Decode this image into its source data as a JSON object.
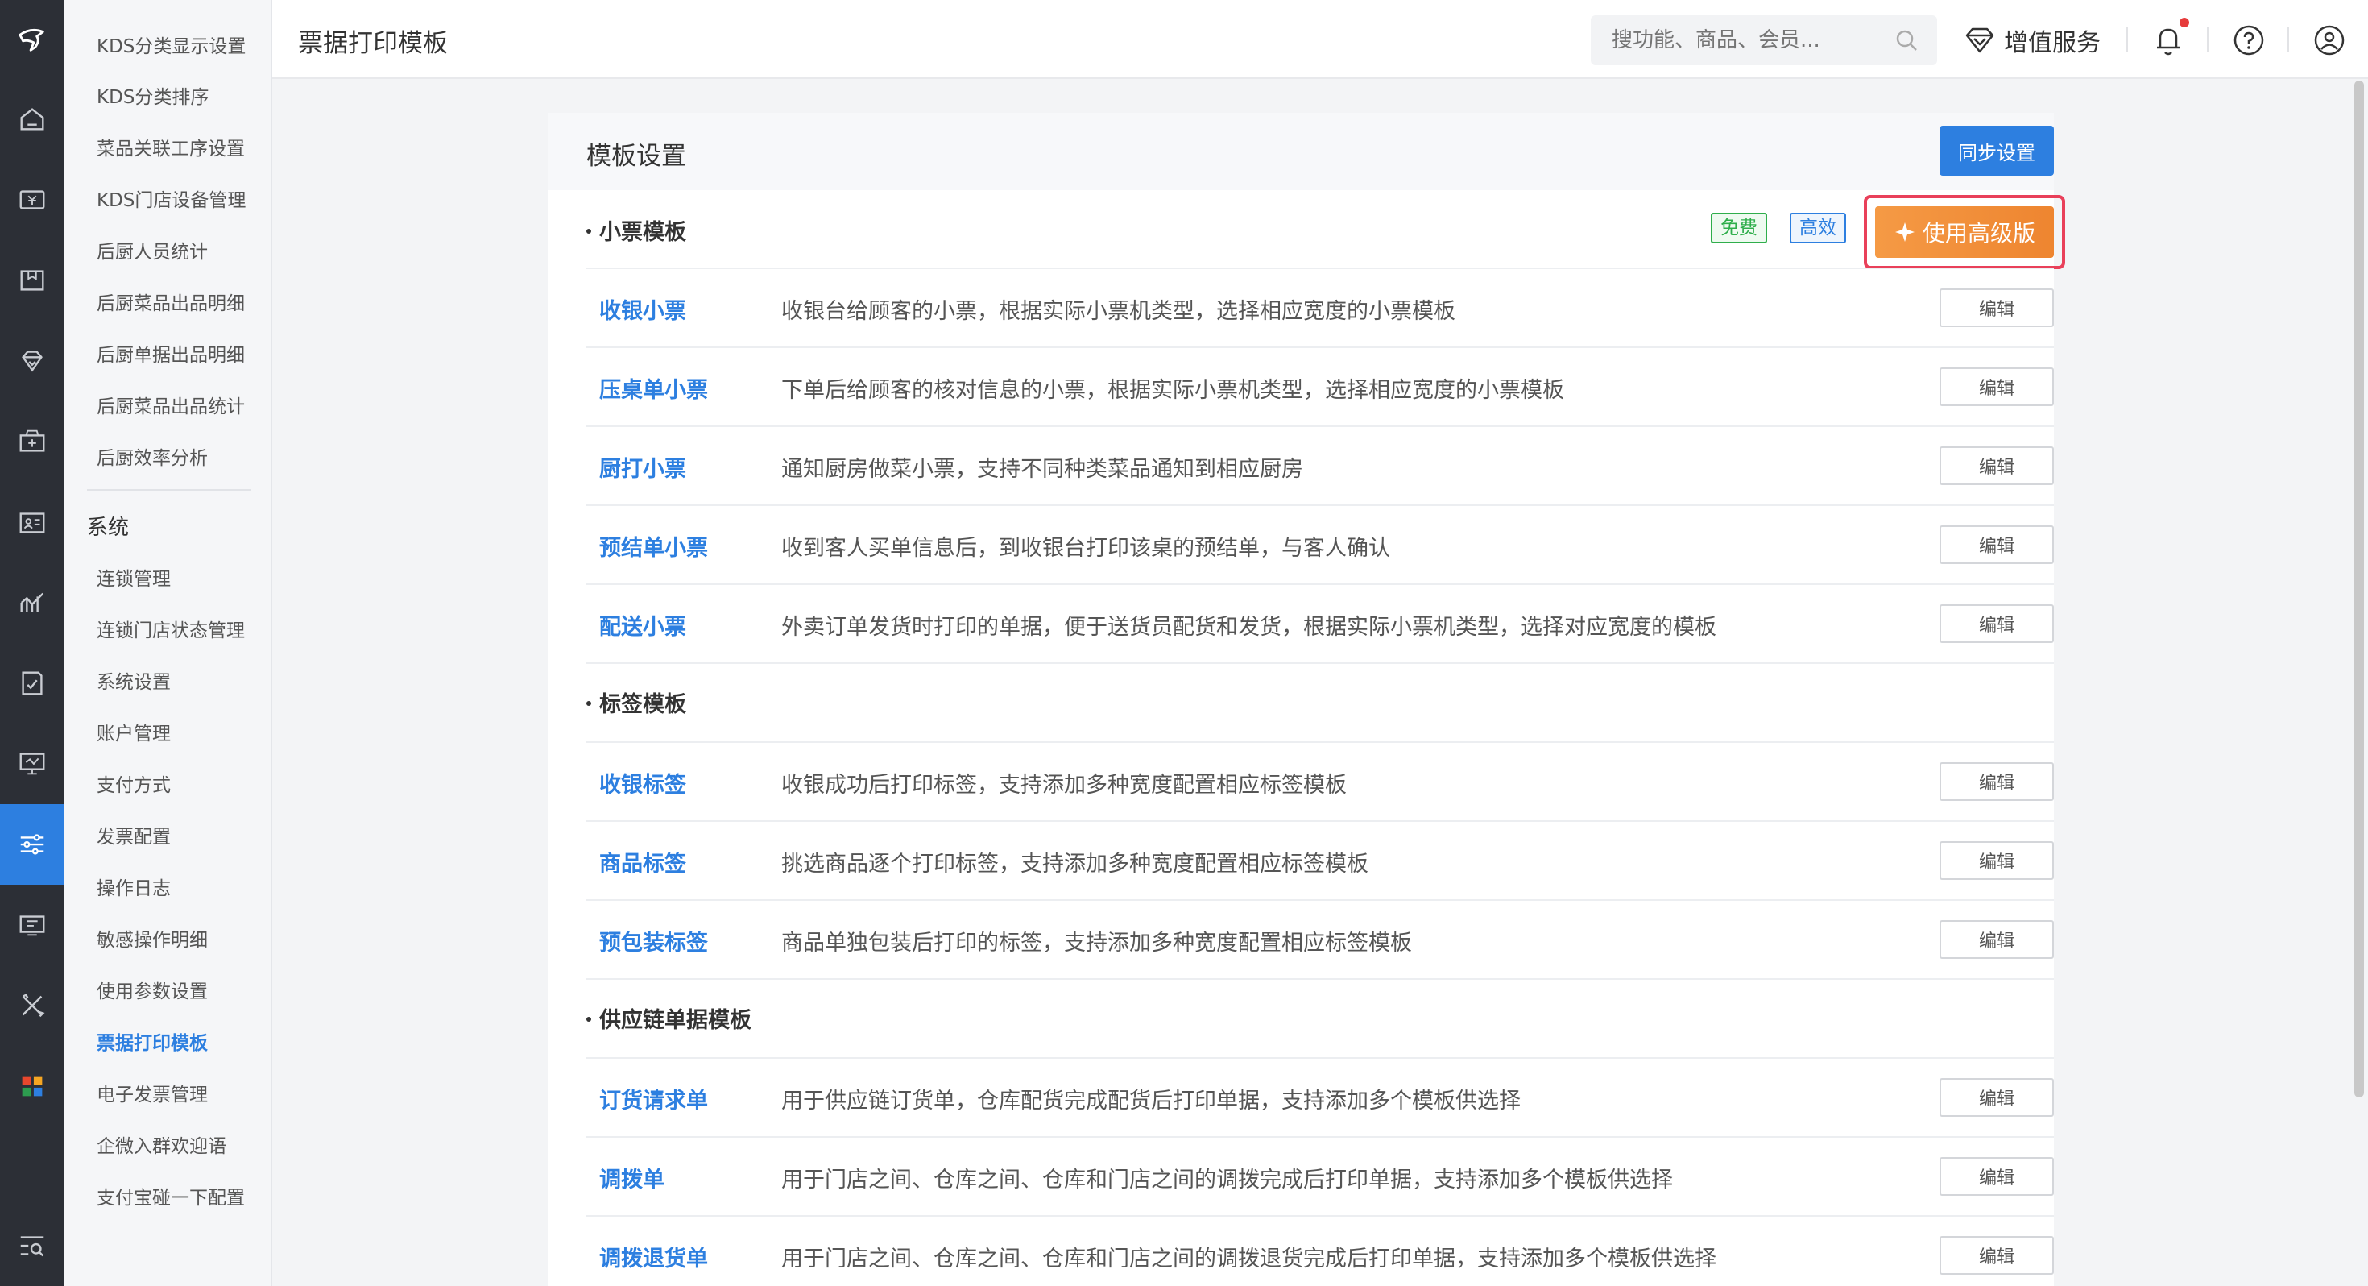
{
  "header": {
    "title": "票据打印模板",
    "search_placeholder": "搜功能、商品、会员...",
    "value_added_service": "增值服务"
  },
  "menu": {
    "items_top": [
      "KDS分类显示设置",
      "KDS分类排序",
      "菜品关联工序设置",
      "KDS门店设备管理",
      "后厨人员统计",
      "后厨菜品出品明细",
      "后厨单据出品明细",
      "后厨菜品出品统计",
      "后厨效率分析"
    ],
    "group_label": "系统",
    "items_system": [
      "连锁管理",
      "连锁门店状态管理",
      "系统设置",
      "账户管理",
      "支付方式",
      "发票配置",
      "操作日志",
      "敏感操作明细",
      "使用参数设置",
      "票据打印模板",
      "电子发票管理",
      "企微入群欢迎语",
      "支付宝碰一下配置"
    ],
    "active_item": "票据打印模板"
  },
  "card": {
    "title": "模板设置",
    "sync_label": "同步设置",
    "tag_free": "免费",
    "tag_efficient": "高效",
    "advanced_label": "使用高级版",
    "edit_label": "编辑",
    "sections": [
      {
        "title": "小票模板",
        "rows": [
          {
            "name": "收银小票",
            "desc": "收银台给顾客的小票，根据实际小票机类型，选择相应宽度的小票模板"
          },
          {
            "name": "压桌单小票",
            "desc": "下单后给顾客的核对信息的小票，根据实际小票机类型，选择相应宽度的小票模板"
          },
          {
            "name": "厨打小票",
            "desc": "通知厨房做菜小票，支持不同种类菜品通知到相应厨房"
          },
          {
            "name": "预结单小票",
            "desc": "收到客人买单信息后，到收银台打印该桌的预结单，与客人确认"
          },
          {
            "name": "配送小票",
            "desc": "外卖订单发货时打印的单据，便于送货员配货和发货，根据实际小票机类型，选择对应宽度的模板"
          }
        ]
      },
      {
        "title": "标签模板",
        "rows": [
          {
            "name": "收银标签",
            "desc": "收银成功后打印标签，支持添加多种宽度配置相应标签模板"
          },
          {
            "name": "商品标签",
            "desc": "挑选商品逐个打印标签，支持添加多种宽度配置相应标签模板"
          },
          {
            "name": "预包装标签",
            "desc": "商品单独包装后打印的标签，支持添加多种宽度配置相应标签模板"
          }
        ]
      },
      {
        "title": "供应链单据模板",
        "rows": [
          {
            "name": "订货请求单",
            "desc": "用于供应链订货单，仓库配货完成配货后打印单据，支持添加多个模板供选择"
          },
          {
            "name": "调拨单",
            "desc": "用于门店之间、仓库之间、仓库和门店之间的调拨完成后打印单据，支持添加多个模板供选择"
          },
          {
            "name": "调拨退货单",
            "desc": "用于门店之间、仓库之间、仓库和门店之间的调拨退货完成后打印单据，支持添加多个模板供选择"
          }
        ]
      }
    ]
  }
}
